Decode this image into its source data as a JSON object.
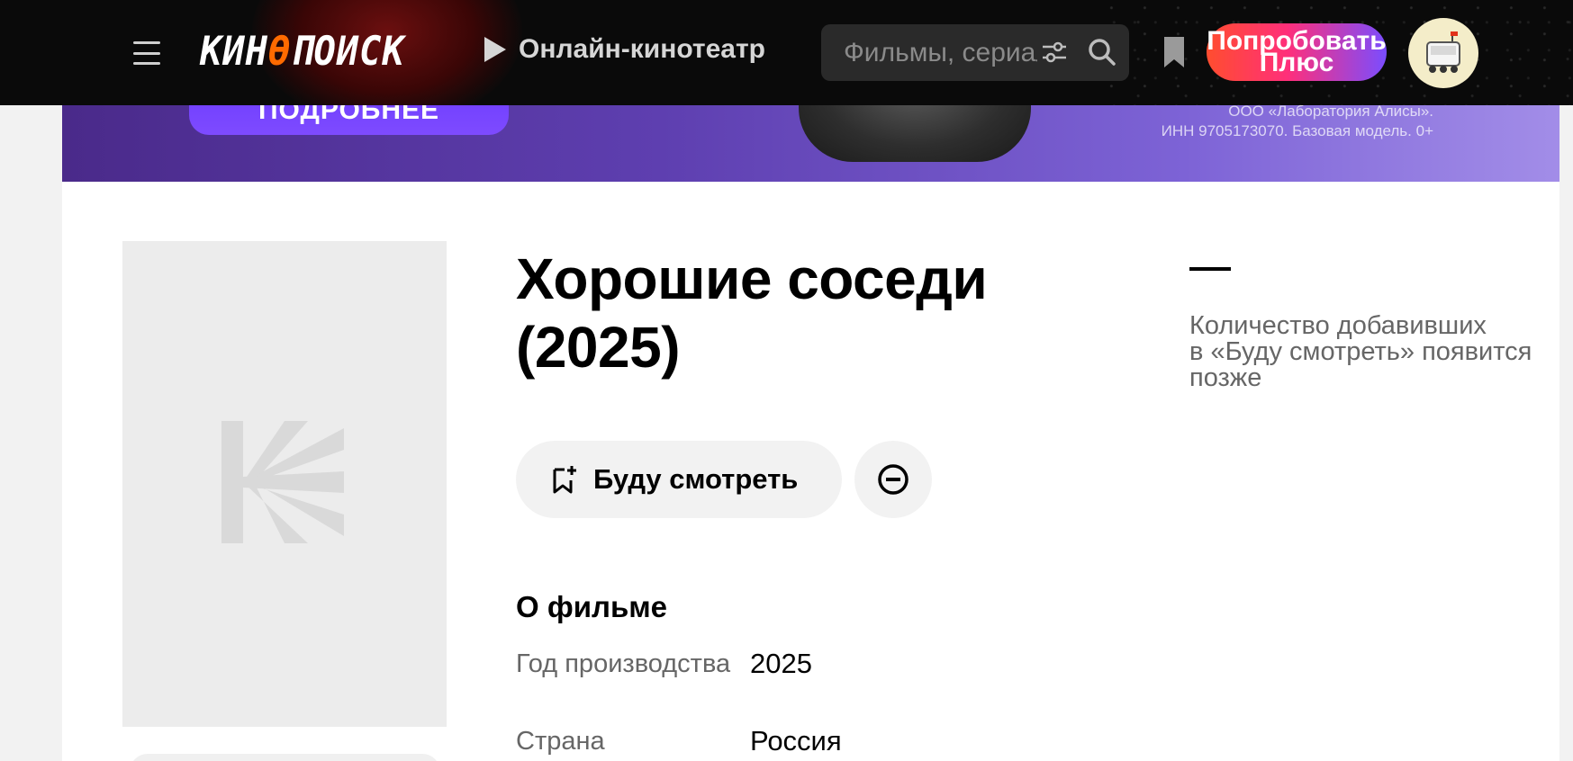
{
  "header": {
    "logo_text": "КИНОПОИСК",
    "logo_accent_color": "#ff6a00",
    "online_label": "Онлайн-кинотеатр",
    "search_placeholder": "Фильмы, сериалы, персоны",
    "plus_label_line1": "Попробовать",
    "plus_label_line2": "Плюс",
    "icons": [
      "menu-icon",
      "play-icon",
      "filter-icon",
      "search-icon",
      "bookmark-icon",
      "avatar-robot-icon"
    ]
  },
  "banner": {
    "more_label": "ПОДРОБНЕЕ",
    "legal_line1": "ООО «Лаборатория Алисы».",
    "legal_line2": "ИНН 9705173070. Базовая модель. 0+"
  },
  "movie": {
    "title_line1": "Хорошие соседи",
    "title_line2": "(2025)",
    "watch_label": "Буду смотреть",
    "about_heading": "О фильме",
    "info": [
      {
        "key": "Год производства",
        "value": "2025"
      },
      {
        "key": "Страна",
        "value": "Россия"
      }
    ]
  },
  "rating": {
    "dash": "—",
    "note_line1": "Количество добавивших",
    "note_line2": "в «Буду смотреть» появится",
    "note_line3": "позже"
  },
  "colors": {
    "header_bg": "#0a0a0a",
    "banner_purple": "#6d3cff",
    "plus_gradient_start": "#ff4d2f",
    "plus_gradient_end": "#7a4dff"
  }
}
